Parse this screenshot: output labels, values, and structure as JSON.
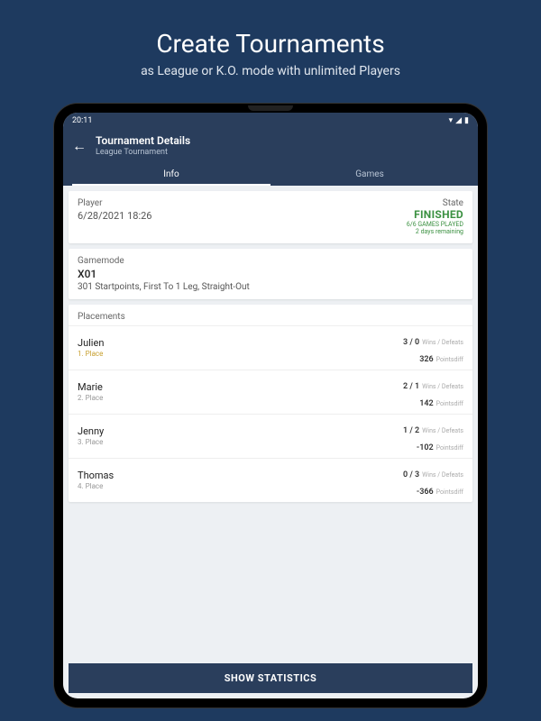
{
  "promo": {
    "title": "Create Tournaments",
    "subtitle": "as League or K.O. mode with unlimited Players"
  },
  "statusbar": {
    "time": "20:11"
  },
  "header": {
    "title": "Tournament Details",
    "subtitle": "League Tournament"
  },
  "tabs": {
    "info": "Info",
    "games": "Games"
  },
  "playerCard": {
    "label": "Player",
    "datetime": "6/28/2021 18:26",
    "stateLabel": "State",
    "stateValue": "FINISHED",
    "stateSub1": "6/6 GAMES PLAYED",
    "stateSub2": "2 days remaining"
  },
  "gamemode": {
    "label": "Gamemode",
    "name": "X01",
    "description": "301 Startpoints, First To 1 Leg, Straight-Out"
  },
  "placements": {
    "title": "Placements",
    "scoreLabel": "Wins / Defeats",
    "diffLabel": "Pointsdiff",
    "rows": [
      {
        "name": "Julien",
        "rank": "1. Place",
        "score": "3 / 0",
        "diff": "326"
      },
      {
        "name": "Marie",
        "rank": "2. Place",
        "score": "2 / 1",
        "diff": "142"
      },
      {
        "name": "Jenny",
        "rank": "3. Place",
        "score": "1 / 2",
        "diff": "-102"
      },
      {
        "name": "Thomas",
        "rank": "4. Place",
        "score": "0 / 3",
        "diff": "-366"
      }
    ]
  },
  "bottomButton": "SHOW STATISTICS"
}
